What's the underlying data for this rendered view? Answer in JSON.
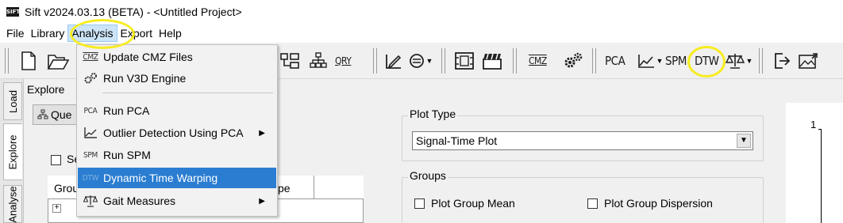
{
  "window": {
    "title": "Sift v2024.03.13 (BETA) - <Untitled Project>",
    "logo_text": "SIFT"
  },
  "menubar": {
    "items": [
      "File",
      "Library",
      "Analysis",
      "Export",
      "Help"
    ]
  },
  "toolbar": {
    "query_label": "QRY",
    "pca_label": "PCA",
    "spm_label": "SPM",
    "dtw_label": "DTW",
    "cmz_label": "CMZ"
  },
  "side_tabs": [
    "Load",
    "Explore",
    "Analyse"
  ],
  "explore": {
    "title": "Explore",
    "query_button": "Que",
    "select_label": "Se",
    "grid_headers": [
      "Grou",
      "pe"
    ],
    "expander": "+"
  },
  "plot_type": {
    "legend": "Plot Type",
    "selected": "Signal-Time Plot"
  },
  "groups": {
    "legend": "Groups",
    "options": [
      "Plot Group Mean",
      "Plot Group Dispersion"
    ]
  },
  "plot": {
    "y_tick": "1"
  },
  "analysis_menu": {
    "items": [
      {
        "label": "Update CMZ Files",
        "icon": "cmz-icon",
        "icon_text": "CMZ",
        "submenu": false
      },
      {
        "label": "Run V3D Engine",
        "icon": "gears-icon",
        "submenu": false
      },
      {
        "label": "Run PCA",
        "icon": "pca-icon",
        "icon_text": "PCA",
        "submenu": false
      },
      {
        "label": "Outlier Detection Using PCA",
        "icon": "outlier-chart-icon",
        "submenu": true
      },
      {
        "label": "Run SPM",
        "icon": "spm-icon",
        "icon_text": "SPM",
        "submenu": false
      },
      {
        "label": "Dynamic Time Warping",
        "icon": "dtw-icon",
        "icon_text": "DTW",
        "submenu": false,
        "highlighted": true
      },
      {
        "label": "Gait Measures",
        "icon": "scale-icon",
        "submenu": true
      }
    ]
  },
  "colors": {
    "highlight": "#2a7dd1",
    "annotation_ring": "#f7ec1f",
    "menu_bg": "#f2f2f2"
  }
}
